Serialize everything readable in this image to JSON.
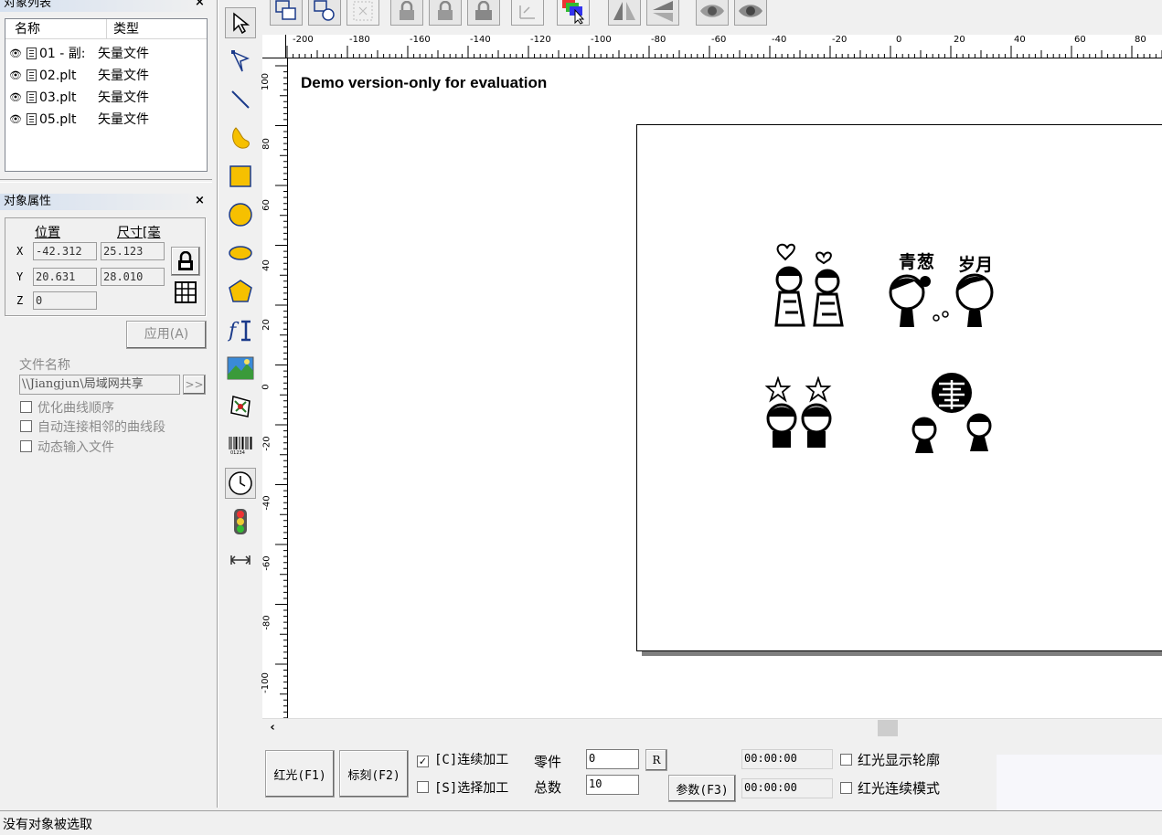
{
  "objects_panel": {
    "title": "对象列表",
    "col_name": "名称",
    "col_type": "类型",
    "rows": [
      {
        "name": "01 - 副:",
        "type": "矢量文件"
      },
      {
        "name": "02.plt",
        "type": "矢量文件"
      },
      {
        "name": "03.plt",
        "type": "矢量文件"
      },
      {
        "name": "05.plt",
        "type": "矢量文件"
      }
    ]
  },
  "props_panel": {
    "title": "对象属性",
    "pos_header": "位置",
    "size_header": "尺寸[毫",
    "x_label": "X",
    "y_label": "Y",
    "z_label": "Z",
    "x_pos": "-42.312",
    "x_size": "25.123",
    "y_pos": "20.631",
    "y_size": "28.010",
    "z_pos": "0",
    "apply_btn": "应用(A)",
    "file_name_label": "文件名称",
    "file_path": "\\\\Jiangjun\\局域网共享",
    "browse_btn": ">>",
    "opt_curve": "优化曲线顺序",
    "opt_connect": "自动连接相邻的曲线段",
    "opt_dynamic": "动态输入文件"
  },
  "ruler": {
    "h_labels": [
      "-200",
      "-180",
      "-160",
      "-140",
      "-120",
      "-100",
      "-80",
      "-60",
      "-40",
      "-20",
      "0",
      "20",
      "40",
      "60",
      "80"
    ],
    "v_labels": [
      "100",
      "80",
      "60",
      "40",
      "20",
      "0",
      "-20",
      "-40",
      "-60",
      "-80",
      "-100"
    ]
  },
  "canvas": {
    "watermark": "Demo version-only for evaluation",
    "art_text_1": "青葱",
    "art_text_2": "岁月"
  },
  "bottom": {
    "red_btn": "红光(F1)",
    "mark_btn": "标刻(F2)",
    "cont_label": "[C]连续加工",
    "cont_checked": true,
    "sel_label": "[S]选择加工",
    "sel_checked": false,
    "parts_label": "零件",
    "parts_value": "0",
    "r_btn": "R",
    "total_label": "总数",
    "total_value": "10",
    "param_btn": "参数(F3)",
    "time1": "00:00:00",
    "time2": "00:00:00",
    "red_outline": "红光显示轮廓",
    "red_cont": "红光连续模式"
  },
  "status": {
    "text": "没有对象被选取"
  }
}
